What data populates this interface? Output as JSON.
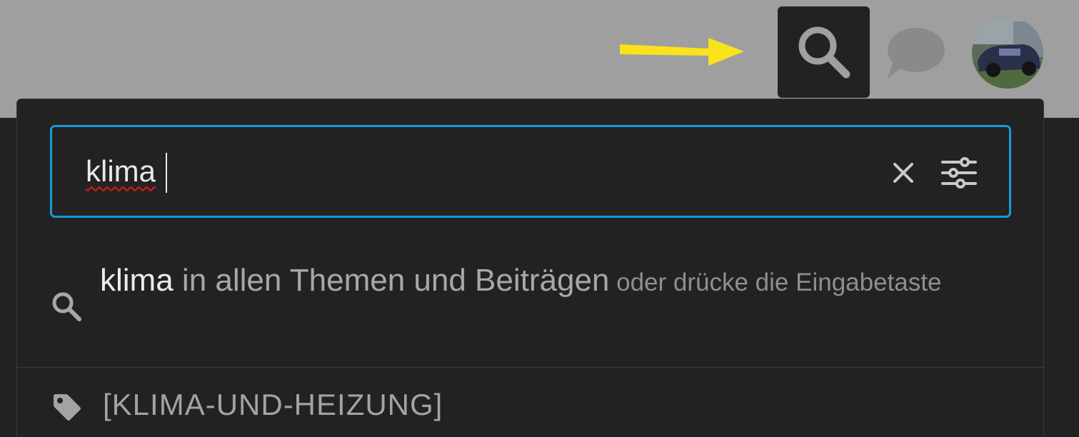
{
  "header": {
    "search_toggle_icon": "search-icon",
    "chat_icon": "chat-bubble-icon",
    "avatar_alt": "user-avatar"
  },
  "search": {
    "value": "klima",
    "clear_icon": "close-icon",
    "filter_icon": "sliders-icon",
    "focus_color": "#169ad8"
  },
  "suggestion": {
    "icon": "search-icon",
    "term": "klima",
    "scope": " in allen Themen und Beiträgen",
    "hint": " oder drücke die Eingabetaste"
  },
  "tag_result": {
    "icon": "tag-icon",
    "label": "[KLIMA-UND-HEIZUNG]"
  },
  "annotations": {
    "arrow_color": "#fae21c"
  }
}
